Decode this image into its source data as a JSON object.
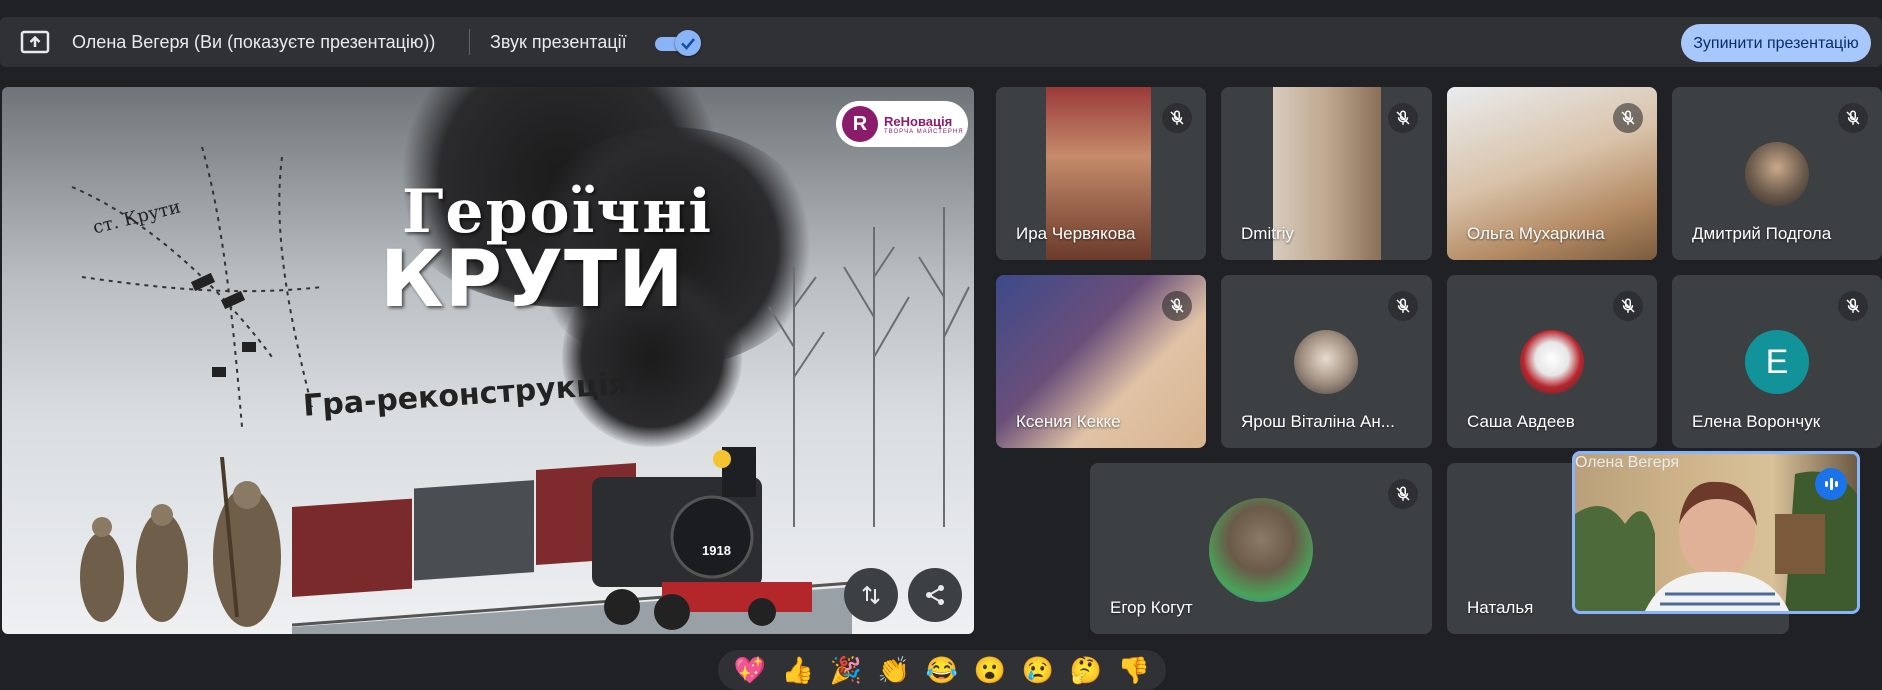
{
  "topbar": {
    "presenter_text": "Олена Вегеря (Ви (показуєте презентацію))",
    "sound_label": "Звук презентації",
    "sound_on": true,
    "stop_button": "Зупинити презентацію"
  },
  "slide": {
    "title_line1": "Героїчні",
    "title_line2": "КРУТИ",
    "subtitle": "Гра-реконструкція",
    "map_label": "ст. Крути",
    "year_plate": "1918",
    "logo_name": "ReНовація",
    "logo_tagline": "ТВОРЧА МАЙСТЕРНЯ",
    "logo_letter": "R"
  },
  "participants": [
    {
      "name": "Ира Червякова",
      "muted": true
    },
    {
      "name": "Dmitriy",
      "muted": true
    },
    {
      "name": "Ольга Мухаркина",
      "muted": true
    },
    {
      "name": "Дмитрий Подгола",
      "muted": true
    },
    {
      "name": "Ксения Кекке",
      "muted": true
    },
    {
      "name": "Ярош Віталіна Ан...",
      "muted": true
    },
    {
      "name": "Саша Авдеев",
      "muted": true
    },
    {
      "name": "Елена Ворончук",
      "muted": true,
      "initial": "E"
    },
    {
      "name": "Егор Когут",
      "muted": true
    },
    {
      "name": "Наталья",
      "muted": false
    }
  ],
  "self_view": {
    "name": "Олена Вегеря",
    "speaking": true
  },
  "reactions": [
    "💖",
    "👍",
    "🎉",
    "👏",
    "😂",
    "😮",
    "😢",
    "🤔",
    "👎"
  ],
  "colors": {
    "accent": "#8ab4f8",
    "tile_bg": "#3c4043",
    "bg": "#202124",
    "avatar_teal": "#12939a"
  }
}
